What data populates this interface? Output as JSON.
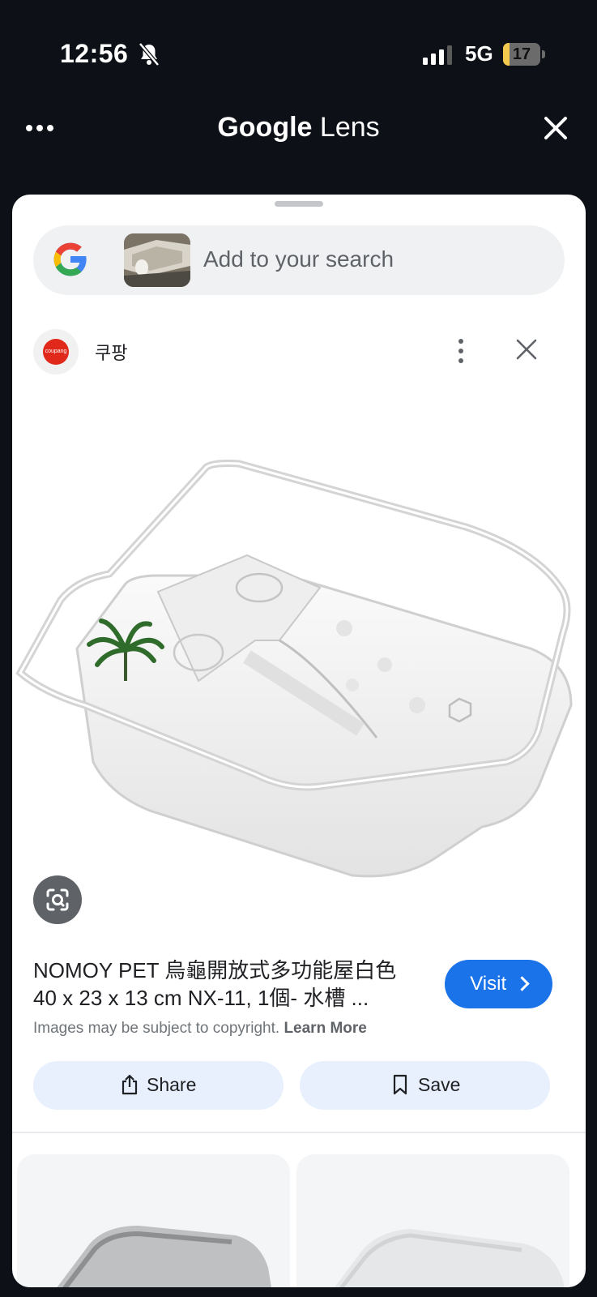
{
  "status": {
    "time": "12:56",
    "network": "5G",
    "battery": "17",
    "battery_level": 0.17
  },
  "header": {
    "title_google": "Google",
    "title_lens": "Lens"
  },
  "search": {
    "placeholder": "Add to your search"
  },
  "source": {
    "name": "쿠팡",
    "logo_text": "coupang"
  },
  "result": {
    "title_line1": "NOMOY PET 烏龜開放式多功能屋白色",
    "title_line2": "40 x 23 x 13 cm NX-11, 1個- 水槽 ...",
    "visit_label": "Visit",
    "copyright_text": "Images may be subject to copyright.",
    "learn_more": "Learn More",
    "share_label": "Share",
    "save_label": "Save"
  },
  "icons": {
    "bell": "bell-slash-icon",
    "menu": "more-horizontal-icon",
    "close": "close-icon",
    "google": "google-g-icon",
    "more": "more-vertical-icon",
    "lens": "lens-search-icon",
    "share": "share-icon",
    "save": "bookmark-icon",
    "chevron": "chevron-right-icon"
  },
  "colors": {
    "accent": "#1a73e8",
    "button_bg": "#e8f0fe",
    "header_bg": "#0d1117",
    "battery": "#f2c94c"
  }
}
